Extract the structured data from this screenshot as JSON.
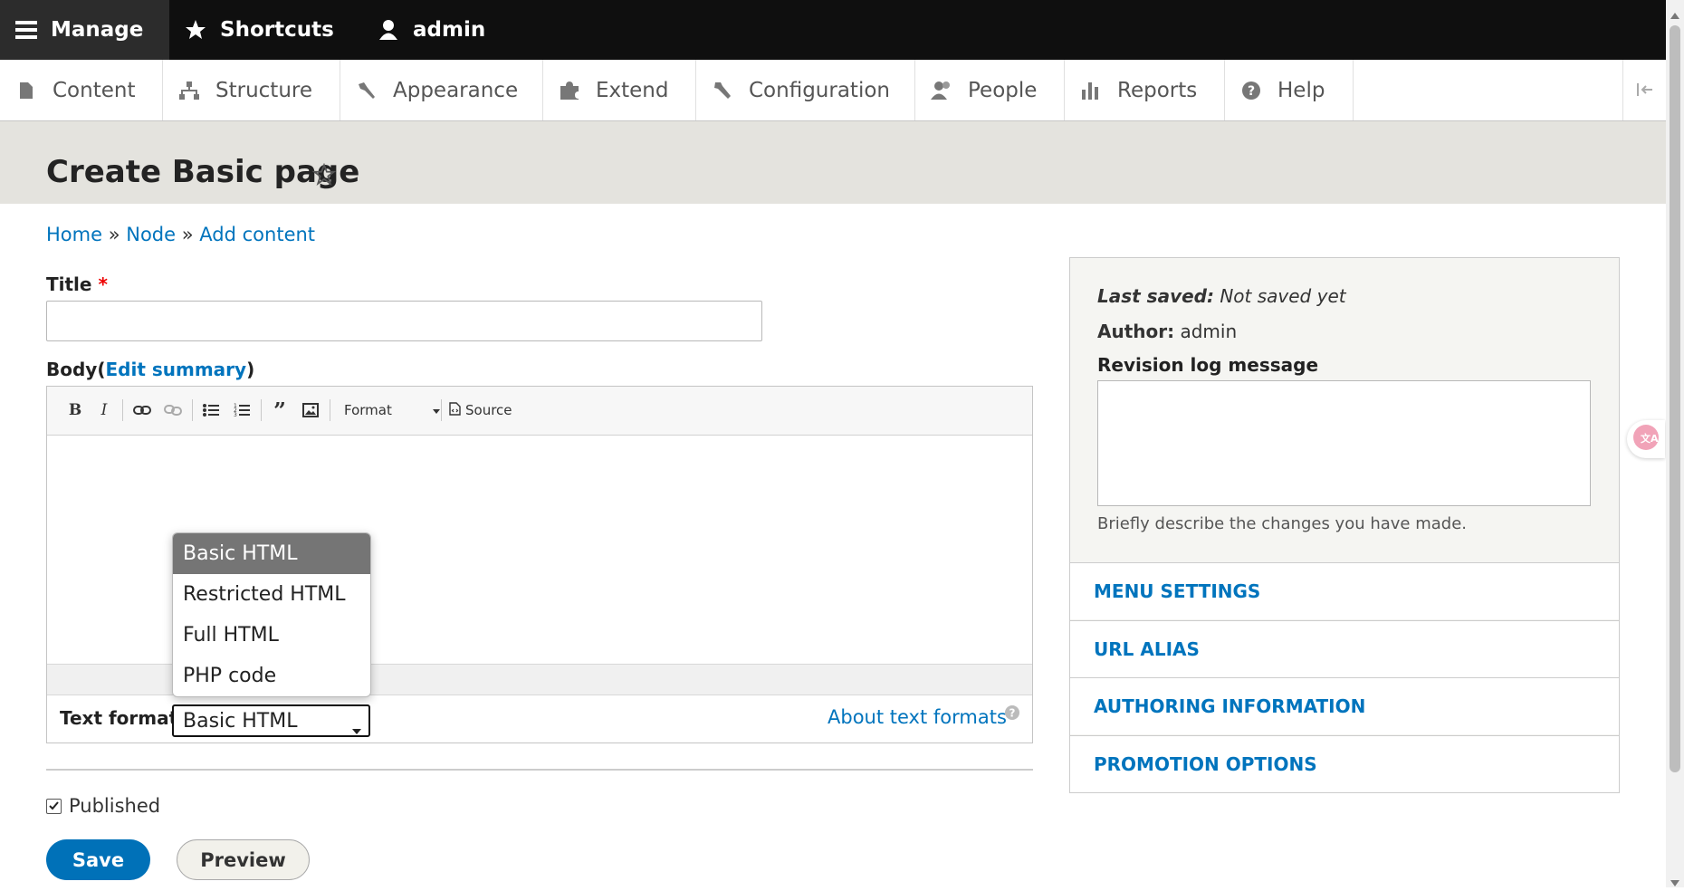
{
  "toolbar": {
    "manage": "Manage",
    "shortcuts": "Shortcuts",
    "user": "admin"
  },
  "tray": {
    "items": [
      "Content",
      "Structure",
      "Appearance",
      "Extend",
      "Configuration",
      "People",
      "Reports",
      "Help"
    ]
  },
  "page": {
    "title": "Create Basic page"
  },
  "breadcrumb": {
    "home": "Home",
    "node": "Node",
    "add_content": "Add content",
    "separator": "»"
  },
  "form": {
    "title_label": "Title",
    "required_mark": "*",
    "title_value": "",
    "body_label": "Body",
    "edit_summary": "Edit summary",
    "editor_format_label": "Format",
    "editor_source_label": "Source",
    "text_format_label": "Text format",
    "text_format_selected": "Basic HTML",
    "text_format_options": [
      "Basic HTML",
      "Restricted HTML",
      "Full HTML",
      "PHP code"
    ],
    "about_text_formats": "About text formats",
    "published_label": "Published",
    "published_checked": true,
    "save_label": "Save",
    "preview_label": "Preview"
  },
  "sidebar": {
    "last_saved_label": "Last saved:",
    "last_saved_value": "Not saved yet",
    "author_label": "Author:",
    "author_value": "admin",
    "revision_label": "Revision log message",
    "revision_value": "",
    "revision_help": "Briefly describe the changes you have made.",
    "sections": [
      "MENU SETTINGS",
      "URL ALIAS",
      "AUTHORING INFORMATION",
      "PROMOTION OPTIONS"
    ]
  },
  "colors": {
    "link": "#0074bd",
    "toolbar_bg": "#0f0f0f",
    "page_head_bg": "#e4e3de",
    "save_bg": "#0071b8",
    "required": "#e00"
  }
}
